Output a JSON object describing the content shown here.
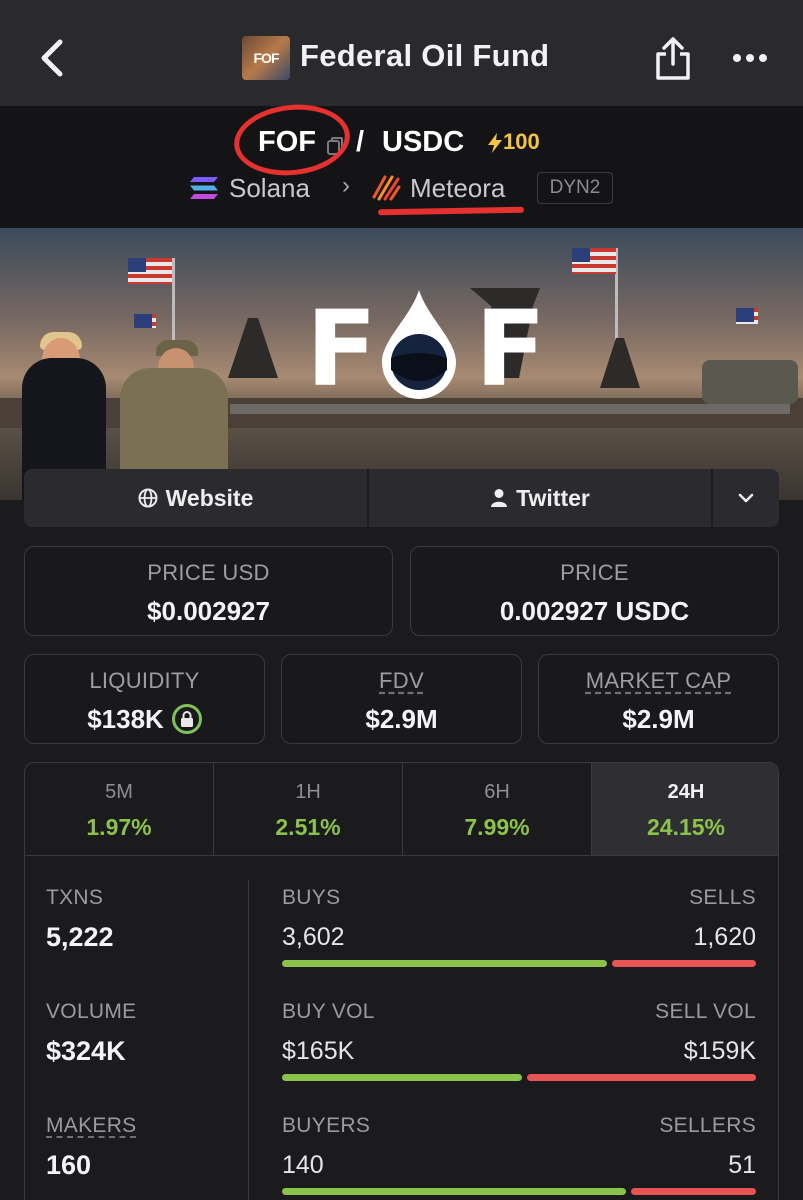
{
  "nav": {
    "title": "Federal Oil Fund",
    "logo_text": "FOF"
  },
  "pair": {
    "base": "FOF",
    "separator": "/",
    "quote": "USDC",
    "boost": "100",
    "chain": "Solana",
    "dex": "Meteora",
    "pool_badge": "DYN2"
  },
  "banner": {
    "logo_text_left": "F",
    "logo_text_right": "F"
  },
  "links": {
    "website": "Website",
    "twitter": "Twitter"
  },
  "stats": {
    "price_usd_label": "PRICE USD",
    "price_usd": "$0.002927",
    "price_label": "PRICE",
    "price": "0.002927 USDC",
    "liquidity_label": "LIQUIDITY",
    "liquidity": "$138K",
    "fdv_label": "FDV",
    "fdv": "$2.9M",
    "mcap_label": "MARKET CAP",
    "mcap": "$2.9M"
  },
  "timeframes": [
    {
      "label": "5M",
      "change": "1.97%"
    },
    {
      "label": "1H",
      "change": "2.51%"
    },
    {
      "label": "6H",
      "change": "7.99%"
    },
    {
      "label": "24H",
      "change": "24.15%"
    }
  ],
  "active_timeframe": "24H",
  "txns": {
    "txns_label": "TXNS",
    "txns": "5,222",
    "buys_label": "BUYS",
    "buys": "3,602",
    "sells_label": "SELLS",
    "sells": "1,620",
    "buy_share": 0.69,
    "volume_label": "VOLUME",
    "volume": "$324K",
    "buy_vol_label": "BUY VOL",
    "buy_vol": "$165K",
    "sell_vol_label": "SELL VOL",
    "sell_vol": "$159K",
    "buy_vol_share": 0.51,
    "makers_label": "MAKERS",
    "makers": "160",
    "buyers_label": "BUYERS",
    "buyers": "140",
    "sellers_label": "SELLERS",
    "sellers": "51",
    "buyer_share": 0.73
  },
  "colors": {
    "positive": "#8bc34a",
    "negative": "#e85353",
    "boost": "#f4c542",
    "highlight": "#e5312f"
  }
}
